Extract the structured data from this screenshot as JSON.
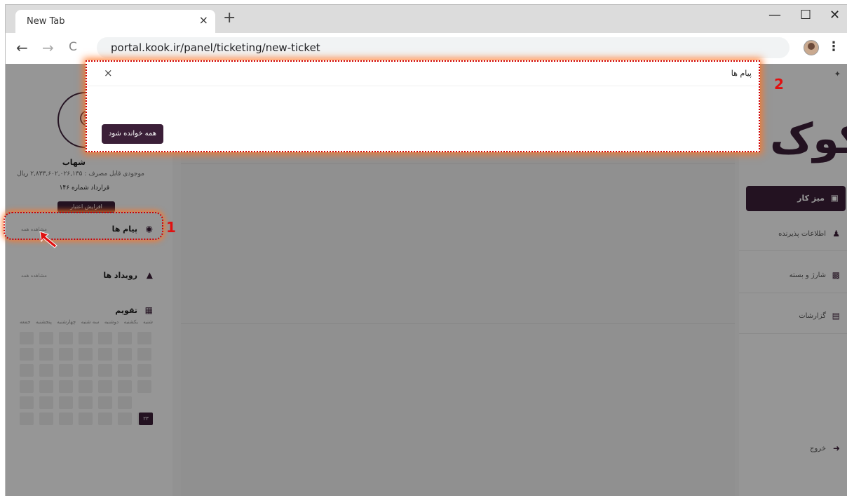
{
  "browser": {
    "tab_title": "New Tab",
    "tab_close": "×",
    "new_tab": "+",
    "controls": {
      "minimize": "—",
      "maximize": "☐",
      "close": "✕"
    },
    "nav": {
      "back": "←",
      "forward": "→",
      "reload": "C"
    },
    "url": "portal.kook.ir/panel/ticketing/new-ticket",
    "menu": "⋮"
  },
  "modal": {
    "title": "پیام ها",
    "close": "×",
    "button_label": "همه خوانده شود"
  },
  "left_panel": {
    "user_name": "شهاب",
    "balance": "موجودی قابل مصرف : ۲,۸۳۳,۶۰۲,۰۲۶,۱۳۵ ریال",
    "contract": "قرارداد شماره ۱۴۶",
    "credit_button": "افزایش اعتبار",
    "messages": {
      "title": "پیام ها",
      "link": "مشاهده همه"
    },
    "events": {
      "title": "رویداد ها",
      "link": "مشاهده همه"
    },
    "calendar": {
      "title": "تقویم",
      "weekdays": [
        "شنبه",
        "یکشنبه",
        "دوشنبه",
        "سه شنبه",
        "چهارشنبه",
        "پنجشنبه",
        "جمعه"
      ],
      "today": "۲۳"
    }
  },
  "right_nav": {
    "logo": "کوک",
    "items": [
      {
        "label": "میز کار",
        "active": true
      },
      {
        "label": "اطلاعات پذیرنده",
        "active": false
      },
      {
        "label": "شارژ و بسته",
        "active": false
      },
      {
        "label": "گزارشات",
        "active": false
      },
      {
        "label": "خروج",
        "active": false
      }
    ]
  },
  "annotations": {
    "first": "1",
    "second": "2"
  },
  "colors": {
    "brand": "#3b1f38",
    "highlight": "#d00000"
  }
}
